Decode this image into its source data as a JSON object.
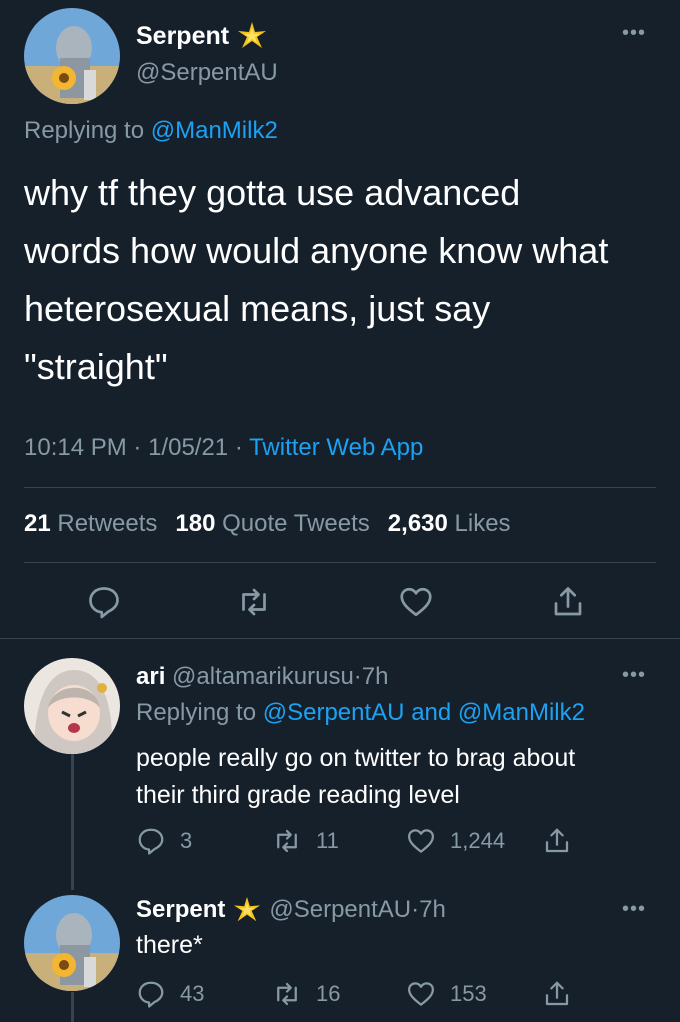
{
  "main_tweet": {
    "author_name": "Serpent",
    "badge_icon": "sparkle-star-emoji",
    "handle": "@SerpentAU",
    "replying_prefix": "Replying to",
    "replying_to": "@ManMilk2",
    "text_lines": [
      "why tf they gotta use advanced",
      "words how would anyone know what",
      "heterosexual means, just say",
      "\"straight\""
    ],
    "time": "10:14 PM",
    "date": "1/05/21",
    "source": "Twitter Web App",
    "stats": {
      "retweets_count": "21",
      "retweets_label": "Retweets",
      "quotes_count": "180",
      "quotes_label": "Quote Tweets",
      "likes_count": "2,630",
      "likes_label": "Likes"
    },
    "actions": [
      "reply-icon",
      "retweet-icon",
      "like-icon",
      "share-icon"
    ]
  },
  "reply_1": {
    "author_name": "ari",
    "handle": "@altamarikurusu",
    "time": "7h",
    "replying_prefix": "Replying to",
    "mention_1": "@SerpentAU",
    "and_word": "and",
    "mention_2": "@ManMilk2",
    "text_lines": [
      "people really go on twitter to brag about",
      "their third grade reading level"
    ],
    "replies": "3",
    "retweets": "11",
    "likes": "1,244"
  },
  "reply_2": {
    "author_name": "Serpent",
    "handle": "@SerpentAU",
    "time": "7h",
    "text": "there*",
    "replies": "43",
    "retweets": "16",
    "likes": "153"
  },
  "separator": "·",
  "more_glyph": "•••",
  "colors": {
    "background": "#15202b",
    "text": "#ffffff",
    "muted": "#8899a6",
    "link": "#1da1f2",
    "divider": "#38444d"
  }
}
